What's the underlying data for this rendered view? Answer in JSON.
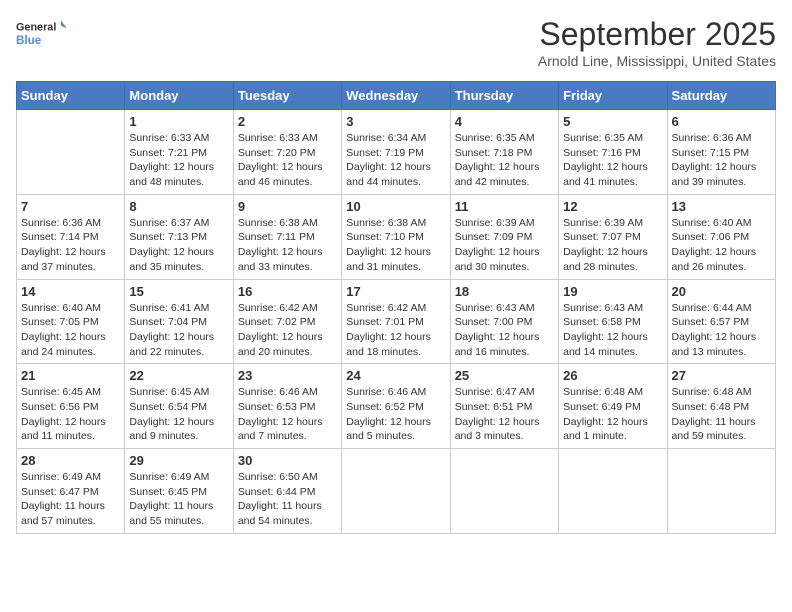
{
  "header": {
    "logo_general": "General",
    "logo_blue": "Blue",
    "month": "September 2025",
    "location": "Arnold Line, Mississippi, United States"
  },
  "weekdays": [
    "Sunday",
    "Monday",
    "Tuesday",
    "Wednesday",
    "Thursday",
    "Friday",
    "Saturday"
  ],
  "weeks": [
    [
      {
        "day": "",
        "info": ""
      },
      {
        "day": "1",
        "info": "Sunrise: 6:33 AM\nSunset: 7:21 PM\nDaylight: 12 hours\nand 48 minutes."
      },
      {
        "day": "2",
        "info": "Sunrise: 6:33 AM\nSunset: 7:20 PM\nDaylight: 12 hours\nand 46 minutes."
      },
      {
        "day": "3",
        "info": "Sunrise: 6:34 AM\nSunset: 7:19 PM\nDaylight: 12 hours\nand 44 minutes."
      },
      {
        "day": "4",
        "info": "Sunrise: 6:35 AM\nSunset: 7:18 PM\nDaylight: 12 hours\nand 42 minutes."
      },
      {
        "day": "5",
        "info": "Sunrise: 6:35 AM\nSunset: 7:16 PM\nDaylight: 12 hours\nand 41 minutes."
      },
      {
        "day": "6",
        "info": "Sunrise: 6:36 AM\nSunset: 7:15 PM\nDaylight: 12 hours\nand 39 minutes."
      }
    ],
    [
      {
        "day": "7",
        "info": "Sunrise: 6:36 AM\nSunset: 7:14 PM\nDaylight: 12 hours\nand 37 minutes."
      },
      {
        "day": "8",
        "info": "Sunrise: 6:37 AM\nSunset: 7:13 PM\nDaylight: 12 hours\nand 35 minutes."
      },
      {
        "day": "9",
        "info": "Sunrise: 6:38 AM\nSunset: 7:11 PM\nDaylight: 12 hours\nand 33 minutes."
      },
      {
        "day": "10",
        "info": "Sunrise: 6:38 AM\nSunset: 7:10 PM\nDaylight: 12 hours\nand 31 minutes."
      },
      {
        "day": "11",
        "info": "Sunrise: 6:39 AM\nSunset: 7:09 PM\nDaylight: 12 hours\nand 30 minutes."
      },
      {
        "day": "12",
        "info": "Sunrise: 6:39 AM\nSunset: 7:07 PM\nDaylight: 12 hours\nand 28 minutes."
      },
      {
        "day": "13",
        "info": "Sunrise: 6:40 AM\nSunset: 7:06 PM\nDaylight: 12 hours\nand 26 minutes."
      }
    ],
    [
      {
        "day": "14",
        "info": "Sunrise: 6:40 AM\nSunset: 7:05 PM\nDaylight: 12 hours\nand 24 minutes."
      },
      {
        "day": "15",
        "info": "Sunrise: 6:41 AM\nSunset: 7:04 PM\nDaylight: 12 hours\nand 22 minutes."
      },
      {
        "day": "16",
        "info": "Sunrise: 6:42 AM\nSunset: 7:02 PM\nDaylight: 12 hours\nand 20 minutes."
      },
      {
        "day": "17",
        "info": "Sunrise: 6:42 AM\nSunset: 7:01 PM\nDaylight: 12 hours\nand 18 minutes."
      },
      {
        "day": "18",
        "info": "Sunrise: 6:43 AM\nSunset: 7:00 PM\nDaylight: 12 hours\nand 16 minutes."
      },
      {
        "day": "19",
        "info": "Sunrise: 6:43 AM\nSunset: 6:58 PM\nDaylight: 12 hours\nand 14 minutes."
      },
      {
        "day": "20",
        "info": "Sunrise: 6:44 AM\nSunset: 6:57 PM\nDaylight: 12 hours\nand 13 minutes."
      }
    ],
    [
      {
        "day": "21",
        "info": "Sunrise: 6:45 AM\nSunset: 6:56 PM\nDaylight: 12 hours\nand 11 minutes."
      },
      {
        "day": "22",
        "info": "Sunrise: 6:45 AM\nSunset: 6:54 PM\nDaylight: 12 hours\nand 9 minutes."
      },
      {
        "day": "23",
        "info": "Sunrise: 6:46 AM\nSunset: 6:53 PM\nDaylight: 12 hours\nand 7 minutes."
      },
      {
        "day": "24",
        "info": "Sunrise: 6:46 AM\nSunset: 6:52 PM\nDaylight: 12 hours\nand 5 minutes."
      },
      {
        "day": "25",
        "info": "Sunrise: 6:47 AM\nSunset: 6:51 PM\nDaylight: 12 hours\nand 3 minutes."
      },
      {
        "day": "26",
        "info": "Sunrise: 6:48 AM\nSunset: 6:49 PM\nDaylight: 12 hours\nand 1 minute."
      },
      {
        "day": "27",
        "info": "Sunrise: 6:48 AM\nSunset: 6:48 PM\nDaylight: 11 hours\nand 59 minutes."
      }
    ],
    [
      {
        "day": "28",
        "info": "Sunrise: 6:49 AM\nSunset: 6:47 PM\nDaylight: 11 hours\nand 57 minutes."
      },
      {
        "day": "29",
        "info": "Sunrise: 6:49 AM\nSunset: 6:45 PM\nDaylight: 11 hours\nand 55 minutes."
      },
      {
        "day": "30",
        "info": "Sunrise: 6:50 AM\nSunset: 6:44 PM\nDaylight: 11 hours\nand 54 minutes."
      },
      {
        "day": "",
        "info": ""
      },
      {
        "day": "",
        "info": ""
      },
      {
        "day": "",
        "info": ""
      },
      {
        "day": "",
        "info": ""
      }
    ]
  ]
}
